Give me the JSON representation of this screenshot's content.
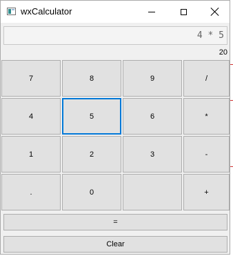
{
  "window": {
    "title": "wxCalculator",
    "controls": [
      "minimize-icon",
      "maximize-icon",
      "close-icon"
    ]
  },
  "display": {
    "expression": "4 * 5",
    "result": "20"
  },
  "keypad": {
    "row1": [
      "7",
      "8",
      "9",
      "/"
    ],
    "row2": [
      "4",
      "5",
      "6",
      "*"
    ],
    "row3": [
      "1",
      "2",
      "3",
      "-"
    ],
    "row4": [
      ".",
      "0",
      "",
      "+"
    ],
    "focused_key": "5"
  },
  "equals_label": "=",
  "clear_label": "Clear"
}
